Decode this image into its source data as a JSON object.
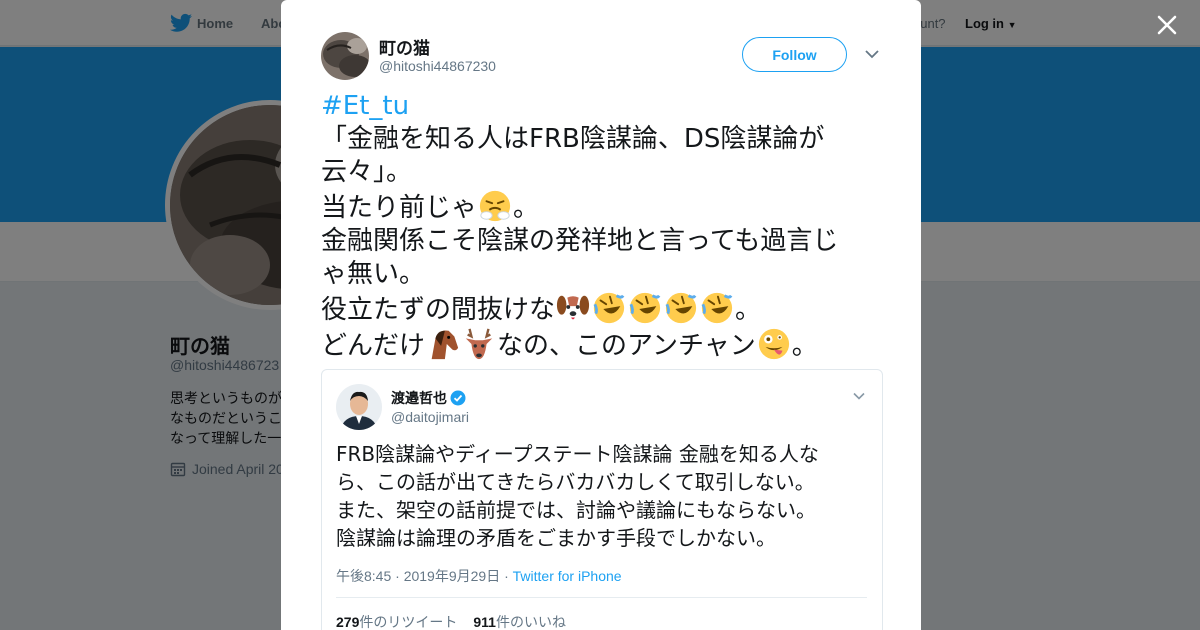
{
  "colors": {
    "accent": "#1da1f2",
    "text": "#14171a",
    "muted": "#657786"
  },
  "topbar": {
    "logo_icon": "twitter-bird-icon",
    "home_label": "Home",
    "about_label": "Abo",
    "account_prompt": "ccount?",
    "login_label": "Log in"
  },
  "profile": {
    "name": "町の猫",
    "handle": "@hitoshi4486723",
    "bio_lines": [
      "思考というものが",
      "なものだというこ",
      "なって理解した一"
    ],
    "joined": "Joined April 20"
  },
  "modal": {
    "close_icon": "close-icon",
    "author": {
      "name": "町の猫",
      "handle": "@hitoshi44867230"
    },
    "follow_label": "Follow",
    "tweet": {
      "hashtag": "#Et_tu",
      "line1": "「金融を知る人はFRB陰謀論、DS陰謀論が",
      "line2": "云々」。",
      "line3_text": "当たり前じゃ",
      "line3_end": "。",
      "line4": "金融関係こそ陰謀の発祥地と言っても過言じ",
      "line5": "ゃ無い。",
      "line6_text": "役立たずの間抜けな",
      "line6_end": "。",
      "line7_text": "どんだけ",
      "line7_mid": "なの、このアンチャン",
      "line7_end": "。",
      "emojis": [
        "steam-face-emoji",
        "dog-face-emoji",
        "rofl-emoji",
        "rofl-emoji",
        "rofl-emoji",
        "rofl-emoji",
        "horse-emoji",
        "deer-emoji",
        "zany-face-emoji"
      ]
    },
    "quoted": {
      "name": "渡邉哲也",
      "handle": "@daitojimari",
      "text_lines": [
        "FRB陰謀論やディープステート陰謀論 金融を知る人な",
        "ら、この話が出てきたらバカバカしくて取引しない。",
        "また、架空の話前提では、討論や議論にもならない。",
        "陰謀論は論理の矛盾をごまかす手段でしかない。"
      ],
      "time": "午後8:45 · 2019年9月29日 · ",
      "source": "Twitter for iPhone",
      "retweet_count": "279",
      "retweet_label": "件のリツイート",
      "like_count": "911",
      "like_label": "件のいいね"
    }
  }
}
